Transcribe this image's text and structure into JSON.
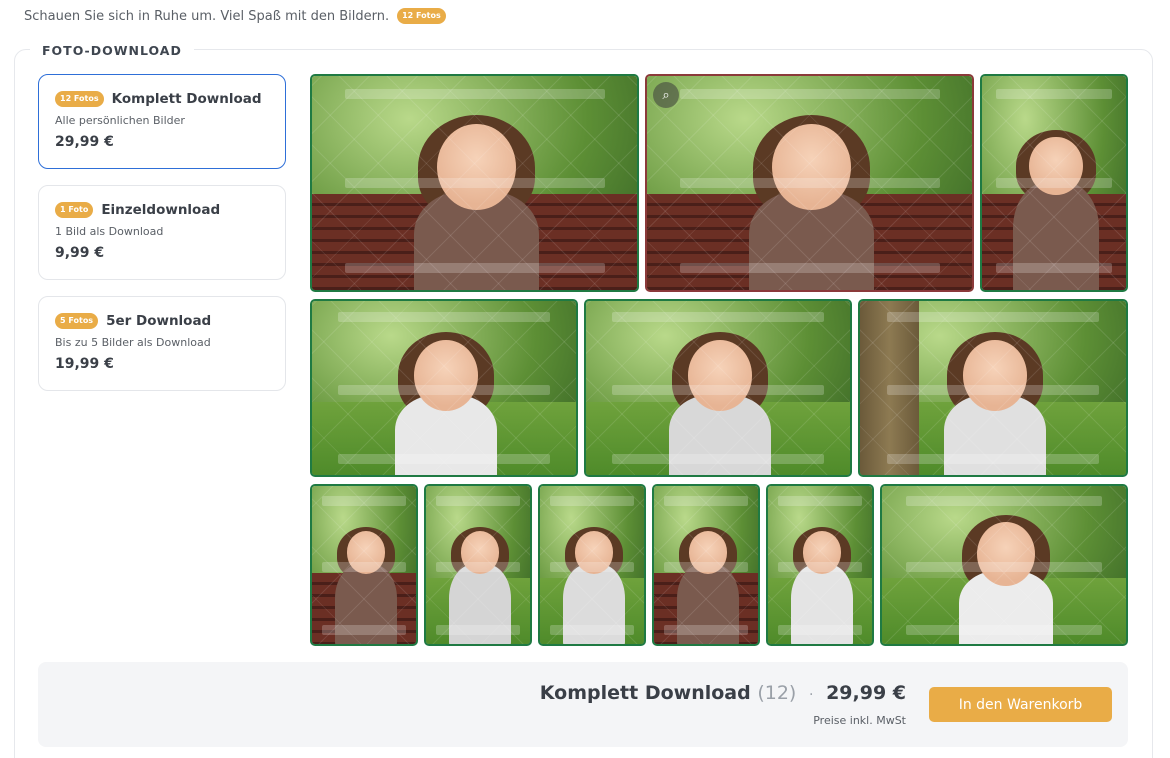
{
  "intro": {
    "text": "Schauen Sie sich in Ruhe um. Viel Spaß mit den Bildern.",
    "badge": "12 Fotos"
  },
  "section": {
    "legend": "FOTO-DOWNLOAD"
  },
  "options": [
    {
      "badge": "12 Fotos",
      "title": "Komplett Download",
      "description": "Alle persönlichen Bilder",
      "price": "29,99 €",
      "selected": true
    },
    {
      "badge": "1 Foto",
      "title": "Einzeldownload",
      "description": "1 Bild als Download",
      "price": "9,99 €",
      "selected": false
    },
    {
      "badge": "5 Fotos",
      "title": "5er Download",
      "description": "Bis zu 5 Bilder als Download",
      "price": "19,99 €",
      "selected": false
    }
  ],
  "photos": [
    {
      "name": "photo-1",
      "scene": "bench",
      "zoom": false
    },
    {
      "name": "photo-2",
      "scene": "bench",
      "zoom": true
    },
    {
      "name": "photo-3",
      "scene": "bench",
      "zoom": false
    },
    {
      "name": "photo-4",
      "scene": "park",
      "zoom": false
    },
    {
      "name": "photo-5",
      "scene": "park",
      "zoom": false
    },
    {
      "name": "photo-6",
      "scene": "tree",
      "zoom": false
    },
    {
      "name": "photo-7",
      "scene": "bench",
      "zoom": false
    },
    {
      "name": "photo-8",
      "scene": "park",
      "zoom": false
    },
    {
      "name": "photo-9",
      "scene": "park",
      "zoom": false
    },
    {
      "name": "photo-10",
      "scene": "bench",
      "zoom": false
    },
    {
      "name": "photo-11",
      "scene": "park",
      "zoom": false
    },
    {
      "name": "photo-12",
      "scene": "park",
      "zoom": false
    }
  ],
  "summary": {
    "title": "Komplett Download",
    "count": "(12)",
    "separator": "·",
    "price": "29,99 €",
    "note": "Preise inkl. MwSt",
    "button": "In den Warenkorb"
  },
  "colors": {
    "accent": "#e9ac47",
    "selected_border": "#2e6fd8",
    "photo_border": "#1f7a43"
  },
  "icons": {
    "zoom": "magnifier-icon"
  }
}
